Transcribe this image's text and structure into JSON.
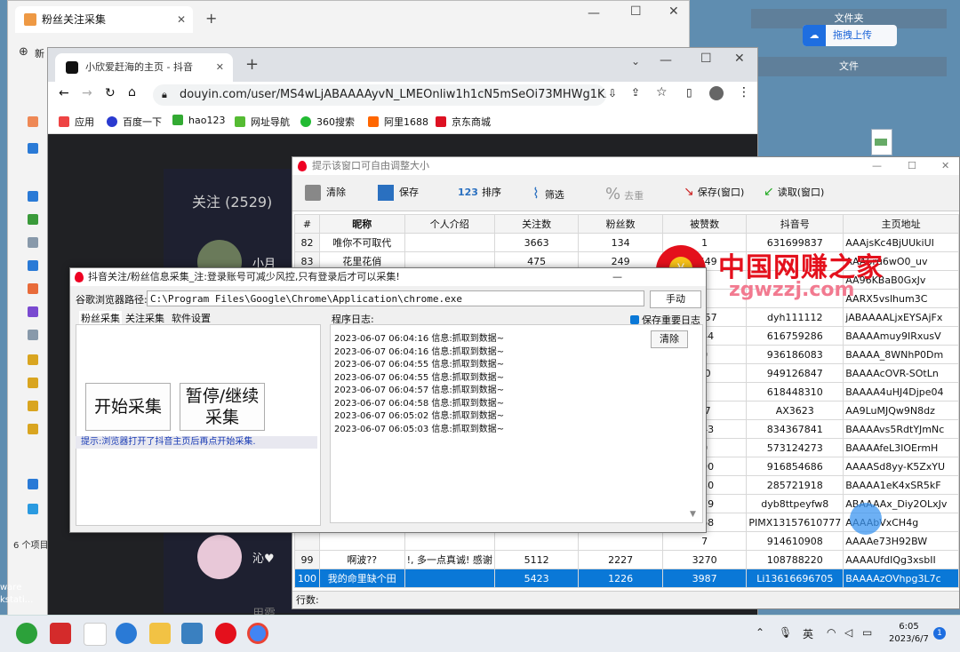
{
  "desktop": {
    "panel_folder": "文件夹",
    "upload_label": "拖拽上传",
    "panel_file": "文件",
    "left_texts": [
      "6 个项目",
      "ware",
      "kstati..."
    ]
  },
  "edge": {
    "tab_title": "粉丝关注采集",
    "new_tab_hint": "新"
  },
  "chrome": {
    "tab_title": "小欣爱赶海的主页 - 抖音",
    "url": "douyin.com/user/MS4wLjABAAAAyvN_LMEOnliw1h1cN5mSeOi73MHWg1KxUaT...",
    "bookmarks": [
      "应用",
      "百度一下",
      "hao123",
      "网址导航",
      "360搜索",
      "阿里1688",
      "京东商城"
    ],
    "douyin_follow": "关注 (2529)",
    "douyin_names": [
      "小月",
      "沁♥",
      "用霞"
    ]
  },
  "main": {
    "title": "提示该窗口可自由调整大小",
    "toolbar": [
      "清除",
      "保存",
      "排序",
      "筛选",
      "去重",
      "保存(窗口)",
      "读取(窗口)"
    ],
    "columns": [
      "#",
      "昵称",
      "个人介绍",
      "关注数",
      "粉丝数",
      "被赞数",
      "抖音号",
      "主页地址"
    ],
    "rows": [
      [
        "82",
        "唯你不可取代",
        "",
        "3663",
        "134",
        "1",
        "631699837",
        "AAAjsKc4BjUUkiUI"
      ],
      [
        "83",
        "花里花俏",
        "",
        "475",
        "249",
        "1649",
        "",
        "AAA6ru6wO0_uv"
      ],
      [
        "",
        "",
        "",
        "",
        "",
        "",
        "",
        "AA96KBaB0GxJv"
      ],
      [
        "",
        "",
        "",
        "",
        "",
        "",
        "",
        "AARX5vslhum3C"
      ],
      [
        "",
        "",
        "",
        "",
        "",
        "2257",
        "dyh111112",
        "jABAAAALjxEYSAjFx"
      ],
      [
        "",
        "",
        "",
        "",
        "",
        "044",
        "616759286",
        "BAAAAmuy9IRxusV"
      ],
      [
        "",
        "",
        "",
        "",
        "",
        "0",
        "936186083",
        "BAAAA_8WNhP0Dm"
      ],
      [
        "",
        "",
        "",
        "",
        "",
        "20",
        "949126847",
        "BAAAAcOVR-SOtLn"
      ],
      [
        "",
        "",
        "",
        "",
        "",
        "2",
        "618448310",
        "BAAAA4uHJ4Djpe04"
      ],
      [
        "",
        "",
        "",
        "",
        "",
        "27",
        "AX3623",
        "AA9LuMJQw9N8dz"
      ],
      [
        "",
        "",
        "",
        "",
        "",
        "843",
        "834367841",
        "BAAAAvs5RdtYJmNc"
      ],
      [
        "",
        "",
        "",
        "",
        "",
        "0",
        "573124273",
        "BAAAAfeL3IOErmH"
      ],
      [
        "",
        "",
        "",
        "",
        "",
        "990",
        "916854686",
        "AAAASd8yy-K5ZxYU"
      ],
      [
        "",
        "",
        "",
        "",
        "",
        "430",
        "285721918",
        "BAAAA1eK4xSR5kF"
      ],
      [
        "",
        "",
        "",
        "",
        "",
        "079",
        "dyb8ttpeyfw8",
        "ABAAAAx_Diy2OLxJv"
      ],
      [
        "",
        "",
        "",
        "",
        "",
        "168",
        "PIMX13157610777",
        "AAAAbVxCH4g"
      ],
      [
        "",
        "",
        "",
        "",
        "",
        "7",
        "914610908",
        "AAAAe73H92BW"
      ],
      [
        "99",
        "啊波??",
        "!, 多一点真诚! 感谢",
        "5112",
        "2227",
        "3270",
        "108788220",
        "AAAAUfdIQg3xsbII"
      ],
      [
        "100",
        "我的命里缺个田",
        "",
        "5423",
        "1226",
        "3987",
        "Li13616696705",
        "BAAAAzOVhpg3L7c"
      ]
    ],
    "status_label": "行数:"
  },
  "dialog": {
    "title": "抖音关注/粉丝信息采集_注:登录账号可减少风控,只有登录后才可以采集!",
    "path_label": "谷歌浏览器路径:",
    "path_value": "C:\\Program Files\\Google\\Chrome\\Application\\chrome.exe",
    "hand_btn": "手动",
    "tabs": [
      "粉丝采集",
      "关注采集",
      "软件设置"
    ],
    "start_btn": "开始采集",
    "pause_btn": "暂停/继续采集",
    "hint": "提示:浏览器打开了抖音主页后再点开始采集.",
    "log_label": "程序日志:",
    "save_log_label": "保存重要日志",
    "clear_btn": "清除",
    "logs": [
      "2023-06-07 06:04:16 信息:抓取到数据~",
      "2023-06-07 06:04:16 信息:抓取到数据~",
      "2023-06-07 06:04:55 信息:抓取到数据~",
      "2023-06-07 06:04:55 信息:抓取到数据~",
      "2023-06-07 06:04:57 信息:抓取到数据~",
      "2023-06-07 06:04:58 信息:抓取到数据~",
      "2023-06-07 06:05:02 信息:抓取到数据~",
      "2023-06-07 06:05:03 信息:抓取到数据~"
    ]
  },
  "watermark": {
    "line1": "中国网赚之家",
    "line2": "zgwzzj.com"
  },
  "taskbar": {
    "ime": "英",
    "time": "6:05",
    "date": "2023/6/7",
    "notif_count": "1"
  }
}
